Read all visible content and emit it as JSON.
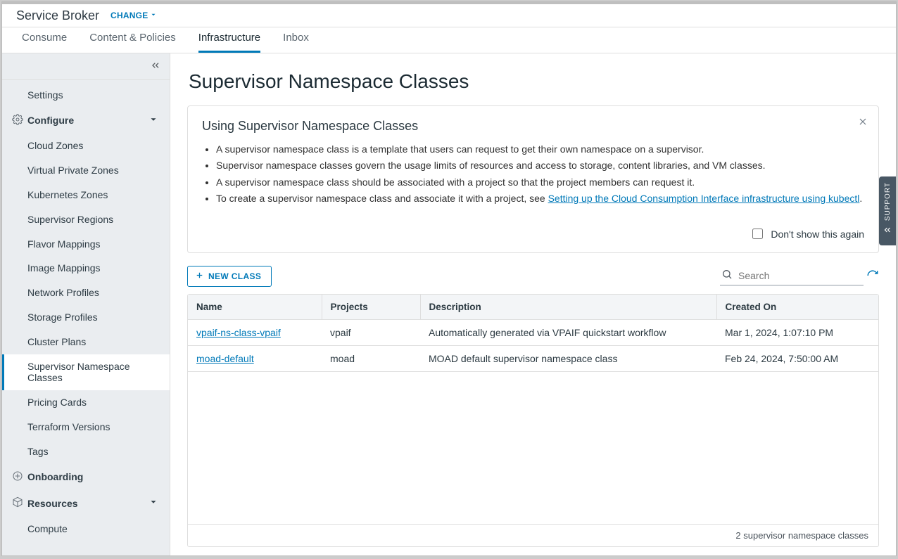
{
  "header": {
    "app_name": "Service Broker",
    "change_label": "CHANGE"
  },
  "tabs": [
    {
      "id": "consume",
      "label": "Consume"
    },
    {
      "id": "content",
      "label": "Content & Policies"
    },
    {
      "id": "infrastructure",
      "label": "Infrastructure",
      "active": true
    },
    {
      "id": "inbox",
      "label": "Inbox"
    }
  ],
  "sidebar": {
    "settings": "Settings",
    "sections": {
      "configure": {
        "title": "Configure",
        "items": [
          "Cloud Zones",
          "Virtual Private Zones",
          "Kubernetes Zones",
          "Supervisor Regions",
          "Flavor Mappings",
          "Image Mappings",
          "Network Profiles",
          "Storage Profiles",
          "Cluster Plans",
          "Supervisor Namespace Classes",
          "Pricing Cards",
          "Terraform Versions",
          "Tags"
        ],
        "active_index": 9
      },
      "onboarding": {
        "title": "Onboarding"
      },
      "resources": {
        "title": "Resources",
        "items": [
          "Compute"
        ]
      }
    }
  },
  "page": {
    "title": "Supervisor Namespace Classes"
  },
  "info": {
    "heading": "Using Supervisor Namespace Classes",
    "bullets": [
      "A supervisor namespace class is a template that users can request to get their own namespace on a supervisor.",
      "Supervisor namespace classes govern the usage limits of resources and access to storage, content libraries, and VM classes.",
      "A supervisor namespace class should be associated with a project so that the project members can request it."
    ],
    "bullet4_prefix": "To create a supervisor namespace class and associate it with a project, see ",
    "bullet4_link": "Setting up the Cloud Consumption Interface infrastructure using kubectl",
    "bullet4_suffix": ".",
    "dont_show": "Don't show this again"
  },
  "toolbar": {
    "new_class": "New Class",
    "search_placeholder": "Search"
  },
  "table": {
    "columns": [
      "Name",
      "Projects",
      "Description",
      "Created On"
    ],
    "rows": [
      {
        "name": "vpaif-ns-class-vpaif",
        "projects": "vpaif",
        "description": "Automatically generated via VPAIF quickstart workflow",
        "created": "Mar 1, 2024, 1:07:10 PM"
      },
      {
        "name": "moad-default",
        "projects": "moad",
        "description": "MOAD default supervisor namespace class",
        "created": "Feb 24, 2024, 7:50:00 AM"
      }
    ],
    "footer": "2 supervisor namespace classes"
  },
  "support_tab": "SUPPORT"
}
